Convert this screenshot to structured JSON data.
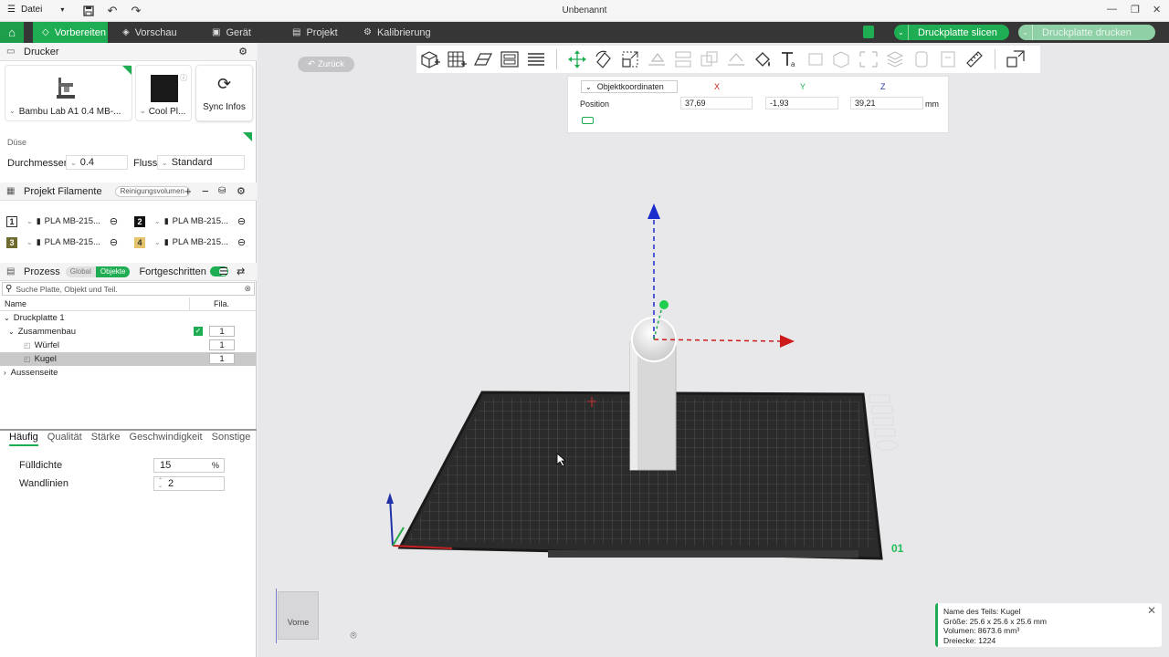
{
  "titlebar": {
    "menu_label": "Datei",
    "title": "Unbenannt"
  },
  "nav": {
    "tabs": [
      {
        "label": "Vorbereiten",
        "active": true
      },
      {
        "label": "Vorschau",
        "active": false
      },
      {
        "label": "Gerät",
        "active": false
      },
      {
        "label": "Projekt",
        "active": false
      },
      {
        "label": "Kalibrierung",
        "active": false
      }
    ],
    "slice_button": "Druckplatte slicen",
    "print_button": "Druckplatte drucken"
  },
  "printer": {
    "section_title": "Drucker",
    "printer_name": "Bambu Lab A1 0.4 MB-...",
    "plate_name": "Cool Pl...",
    "sync_label": "Sync Infos",
    "nozzle_label": "Düse",
    "diameter_label": "Durchmesser",
    "diameter_value": "0.4",
    "flow_label": "Fluss",
    "flow_value": "Standard"
  },
  "filaments": {
    "section_title": "Projekt Filamente",
    "purge_label": "Reinigungsvolumen",
    "items": [
      {
        "num": "1",
        "name": "PLA MB-215...",
        "color": "#ffffff"
      },
      {
        "num": "2",
        "name": "PLA MB-215...",
        "color": "#111111"
      },
      {
        "num": "3",
        "name": "PLA MB-215...",
        "color": "#6f6a2e"
      },
      {
        "num": "4",
        "name": "PLA MB-215...",
        "color": "#e4c36a"
      }
    ]
  },
  "process": {
    "section_title": "Prozess",
    "global_label": "Global",
    "objects_label": "Objekte",
    "advanced_label": "Fortgeschritten",
    "search_placeholder": "Suche Platte, Objekt und Teil.",
    "col_name": "Name",
    "col_fila": "Fila.",
    "tree": {
      "plate": "Druckplatte 1",
      "assembly": "Zusammenbau",
      "assembly_count": "1",
      "cube": "Würfel",
      "cube_count": "1",
      "sphere": "Kugel",
      "sphere_count": "1",
      "outside": "Aussenseite"
    },
    "tabs": [
      "Häufig",
      "Qualität",
      "Stärke",
      "Geschwindigkeit",
      "Sonstige"
    ],
    "infill_label": "Fülldichte",
    "infill_value": "15",
    "infill_unit": "%",
    "walls_label": "Wandlinien",
    "walls_value": "2"
  },
  "viewport": {
    "back_label": "Zurück",
    "coords": {
      "dropdown": "Objektkoordinaten",
      "x_label": "X",
      "y_label": "Y",
      "z_label": "Z",
      "row_label": "Position",
      "x": "37,69",
      "y": "-1,93",
      "z": "39,21",
      "unit": "mm"
    },
    "plate_number": "01",
    "view_cube_label": "Vorne",
    "info": {
      "line1": "Name des Teils: Kugel",
      "line2": "Größe: 25.6 x 25.6 x 25.6 mm",
      "line3": "Volumen: 8673.6 mm³",
      "line4": "Dreiecke: 1224"
    }
  },
  "colors": {
    "accent": "#1fad53",
    "nav_bg": "#363636"
  }
}
